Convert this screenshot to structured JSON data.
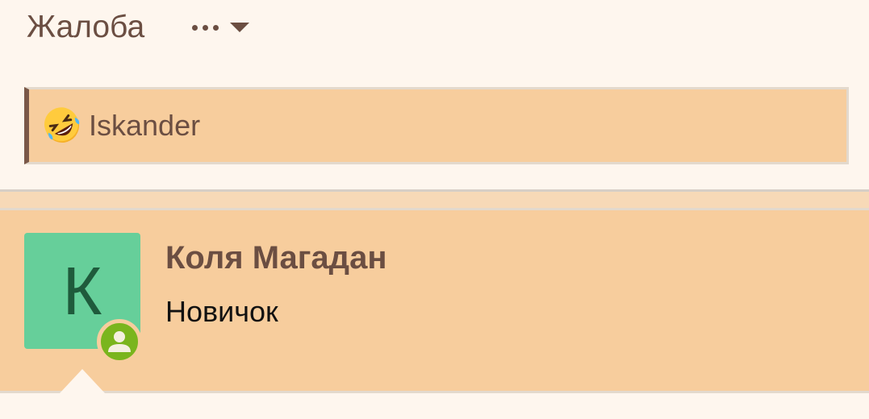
{
  "header": {
    "report_label": "Жалоба",
    "more_menu": {
      "icon": "ellipsis-icon",
      "caret_icon": "caret-down-icon"
    }
  },
  "reactions": {
    "emoji": "rolling-on-floor-laughing-emoji",
    "user": "Iskander"
  },
  "post_author": {
    "avatar_letter": "К",
    "name": "Коля Магадан",
    "title": "Новичок",
    "status_icon": "online-user-icon"
  },
  "colors": {
    "page_bg": "#fef6ee",
    "accent_bg": "#f7cd9d",
    "text": "#6b4e42",
    "avatar_bg": "#66cf9a",
    "online": "#7ab51d"
  }
}
